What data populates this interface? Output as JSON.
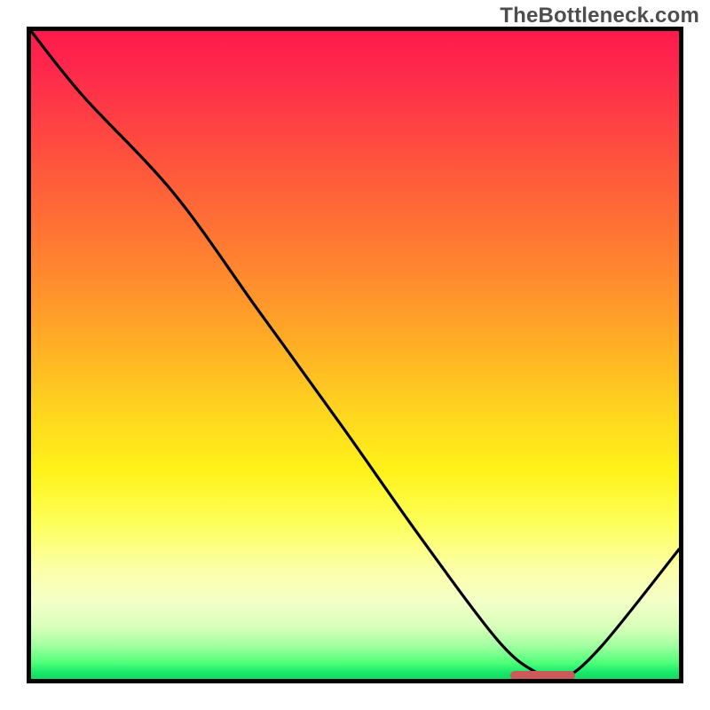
{
  "watermark": "TheBottleneck.com",
  "chart_data": {
    "type": "line",
    "title": "",
    "xlabel": "",
    "ylabel": "",
    "xlim": [
      0,
      100
    ],
    "ylim": [
      0,
      100
    ],
    "grid": false,
    "legend": false,
    "series": [
      {
        "name": "curve",
        "x": [
          0,
          8,
          22,
          35,
          48,
          60,
          72,
          78,
          82,
          88,
          100
        ],
        "values": [
          100,
          90,
          75,
          57,
          39,
          22,
          6,
          1,
          0,
          5,
          20
        ]
      }
    ],
    "marker": {
      "x_start": 74,
      "x_end": 84,
      "y": 0.3,
      "color": "#cc5a5a"
    },
    "background_gradient_stops": [
      {
        "pos": 0.0,
        "color": "#ff1a4d"
      },
      {
        "pos": 0.68,
        "color": "#fff31a"
      },
      {
        "pos": 0.88,
        "color": "#f4ffc8"
      },
      {
        "pos": 1.0,
        "color": "#14d964"
      }
    ]
  }
}
